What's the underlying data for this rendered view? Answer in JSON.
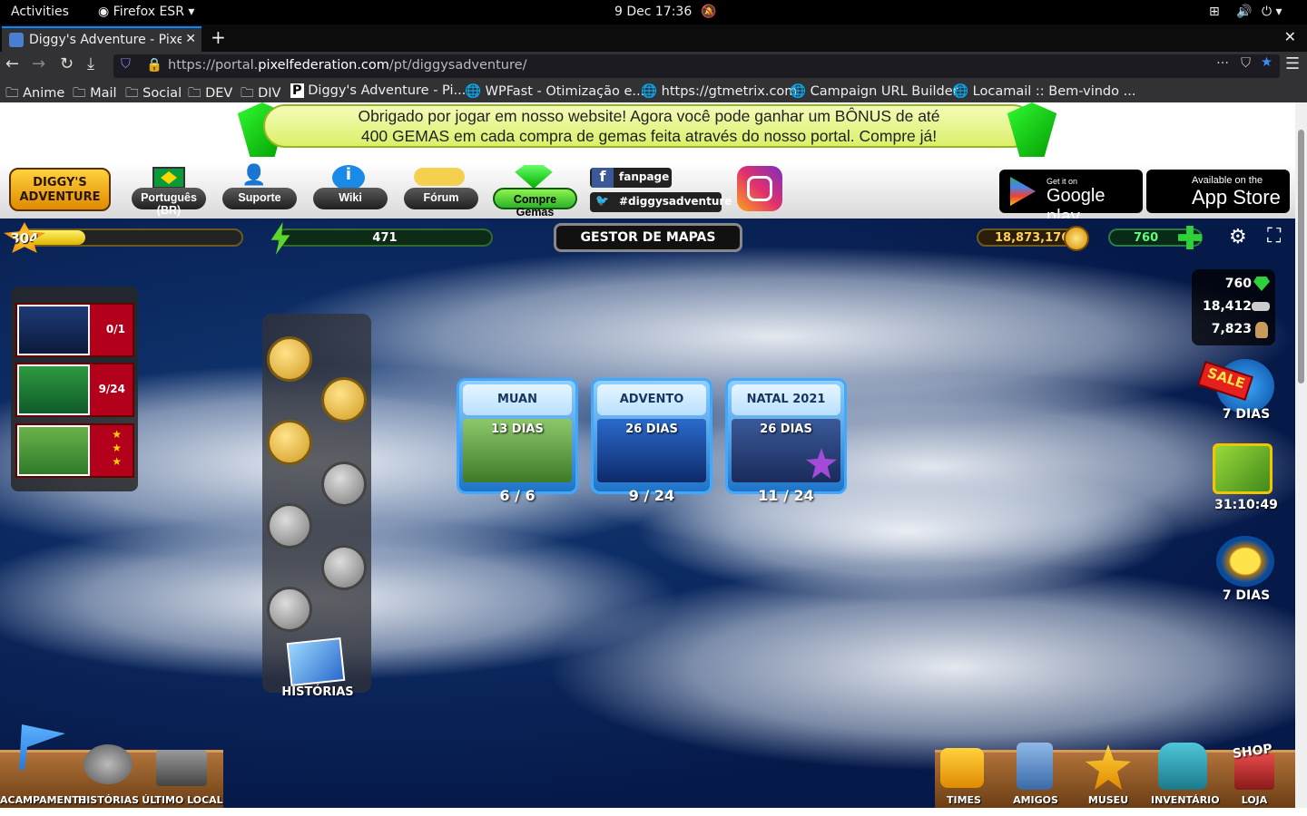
{
  "system": {
    "activities": "Activities",
    "browser": "Firefox ESR",
    "clock": "9 Dec  17:36"
  },
  "browser": {
    "tab_title": "Diggy's Adventure - Pixel",
    "url_prefix": "https://portal.",
    "url_domain": "pixelfederation.com",
    "url_path": "/pt/diggysadventure/"
  },
  "bookmarks": [
    "Anime",
    "Mail",
    "Social",
    "DEV",
    "DIV",
    "Diggy's Adventure - Pi...",
    "WPFast - Otimização e...",
    "https://gtmetrix.com",
    "Campaign URL Builder",
    "Locamail :: Bem-vindo ..."
  ],
  "banner": {
    "line1": "Obrigado por jogar em nosso website! Agora você pode ganhar um BÔNUS de até",
    "line2": "400 GEMAS em cada compra de gemas feita através do nosso portal. Compre já!"
  },
  "menu": {
    "logo": "DIGGY'S ADVENTURE",
    "language": "Português (BR)",
    "support": "Suporte",
    "wiki": "Wiki",
    "forum": "Fórum",
    "buy_gems": "Compre Gemas",
    "fanpage": "fanpage",
    "hashtag": "#diggysadventure",
    "gplay_small": "Get it on",
    "gplay_big": "Google play",
    "appstore_small": "Available on the",
    "appstore_big": "App Store"
  },
  "hud": {
    "level": "304",
    "level_progress": 0.3,
    "energy": "471",
    "map_manager": "GESTOR DE MAPAS",
    "coins": "18,873,176",
    "gems": "760"
  },
  "resources": {
    "gems": "760",
    "materials": "18,412",
    "bags": "7,823"
  },
  "quests": [
    {
      "progress": "0/1"
    },
    {
      "progress": "9/24"
    },
    {
      "progress": "3 stars"
    }
  ],
  "events": [
    {
      "title": "MUAN",
      "days": "13 DIAS",
      "count": "6 / 6"
    },
    {
      "title": "ADVENTO",
      "days": "26 DIAS",
      "count": "9 / 24"
    },
    {
      "title": "NATAL 2021",
      "days": "26 DIAS",
      "count": "11 / 24"
    }
  ],
  "stories_label": "HISTÓRIAS",
  "side": {
    "sale_label": "SALE",
    "sale_days": "7 DIAS",
    "gift_timer": "31:10:49",
    "bottom_days": "7 DIAS"
  },
  "footer_left": [
    "ACAMPAMENTO",
    "HISTÓRIAS",
    "ÚLTIMO LOCAL"
  ],
  "footer_right": [
    "TIMES",
    "AMIGOS",
    "MUSEU",
    "INVENTÁRIO",
    "LOJA"
  ],
  "shop_badge": "SHOP",
  "colors": {
    "accent": "#0a84ff",
    "game_bg": "#0b2358",
    "gem_green": "#2fd13a",
    "gold": "#f5b51b"
  }
}
